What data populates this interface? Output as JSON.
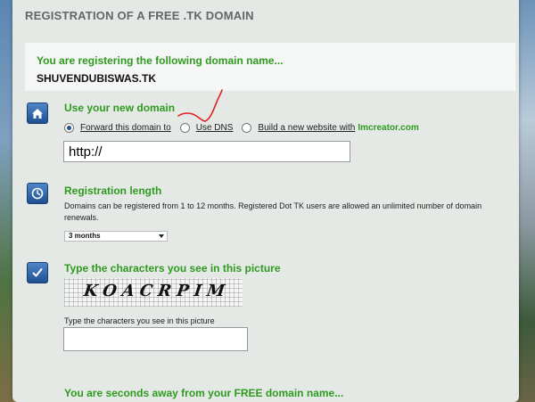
{
  "page": {
    "title": "REGISTRATION OF A FREE .TK DOMAIN"
  },
  "registration": {
    "message": "You are registering the following domain name...",
    "domain": "SHUVENDUBISWAS.TK"
  },
  "section_domain": {
    "icon": "home-icon",
    "heading": "Use your new domain",
    "options": [
      {
        "label": "Forward this domain to",
        "selected": true
      },
      {
        "label": "Use DNS",
        "selected": false
      },
      {
        "label": "Build a new website with",
        "selected": false
      }
    ],
    "brand": "Imcreator.com",
    "url_value": "http://"
  },
  "section_length": {
    "icon": "clock-icon",
    "heading": "Registration length",
    "description": "Domains can be registered from 1 to 12 months. Registered Dot TK users are allowed an unlimited number of domain renewals.",
    "selected_option": "3 months"
  },
  "section_captcha": {
    "icon": "checkmark-icon",
    "heading": "Type the characters you see in this picture",
    "captcha_text": "KOACRPIM",
    "input_label": "Type the characters you see in this picture",
    "input_value": ""
  },
  "footer": {
    "message": "You are seconds away from your FREE domain name..."
  },
  "colors": {
    "accent_green": "#2f9a1f",
    "icon_blue": "#1f4f90",
    "panel": "#e4e9e6",
    "annotation_red": "#e0201f"
  }
}
